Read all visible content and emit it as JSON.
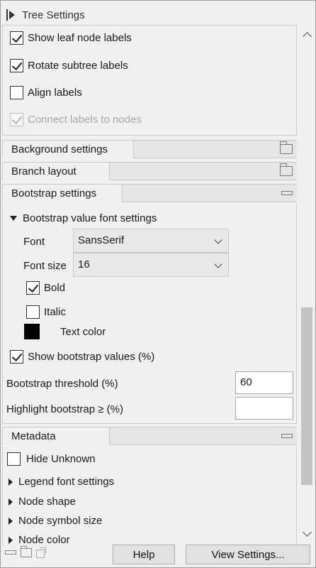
{
  "panel": {
    "title": "Tree Settings"
  },
  "tree_settings": {
    "show_leaf_labels": {
      "label": "Show leaf node labels",
      "checked": true
    },
    "rotate_subtree": {
      "label": "Rotate subtree labels",
      "checked": true
    },
    "align_labels": {
      "label": "Align labels",
      "checked": false
    },
    "connect_labels": {
      "label": "Connect labels to nodes",
      "checked": true,
      "disabled": true
    }
  },
  "sections": {
    "background": "Background settings",
    "branch": "Branch layout",
    "bootstrap": "Bootstrap settings",
    "metadata": "Metadata"
  },
  "bootstrap": {
    "font_group": "Bootstrap value font settings",
    "font_label": "Font",
    "font_value": "SansSerif",
    "size_label": "Font size",
    "size_value": "16",
    "bold_label": "Bold",
    "italic_label": "Italic",
    "text_color_label": "Text color",
    "text_color": "#000000",
    "show_values_label": "Show bootstrap values (%)",
    "threshold_label": "Bootstrap threshold (%)",
    "threshold_value": "60",
    "highlight_label": "Highlight bootstrap ≥ (%)",
    "highlight_value": ""
  },
  "metadata": {
    "hide_unknown": "Hide Unknown",
    "items": [
      "Legend font settings",
      "Node shape",
      "Node symbol size",
      "Node color"
    ]
  },
  "footer": {
    "help": "Help",
    "view_settings": "View Settings..."
  }
}
